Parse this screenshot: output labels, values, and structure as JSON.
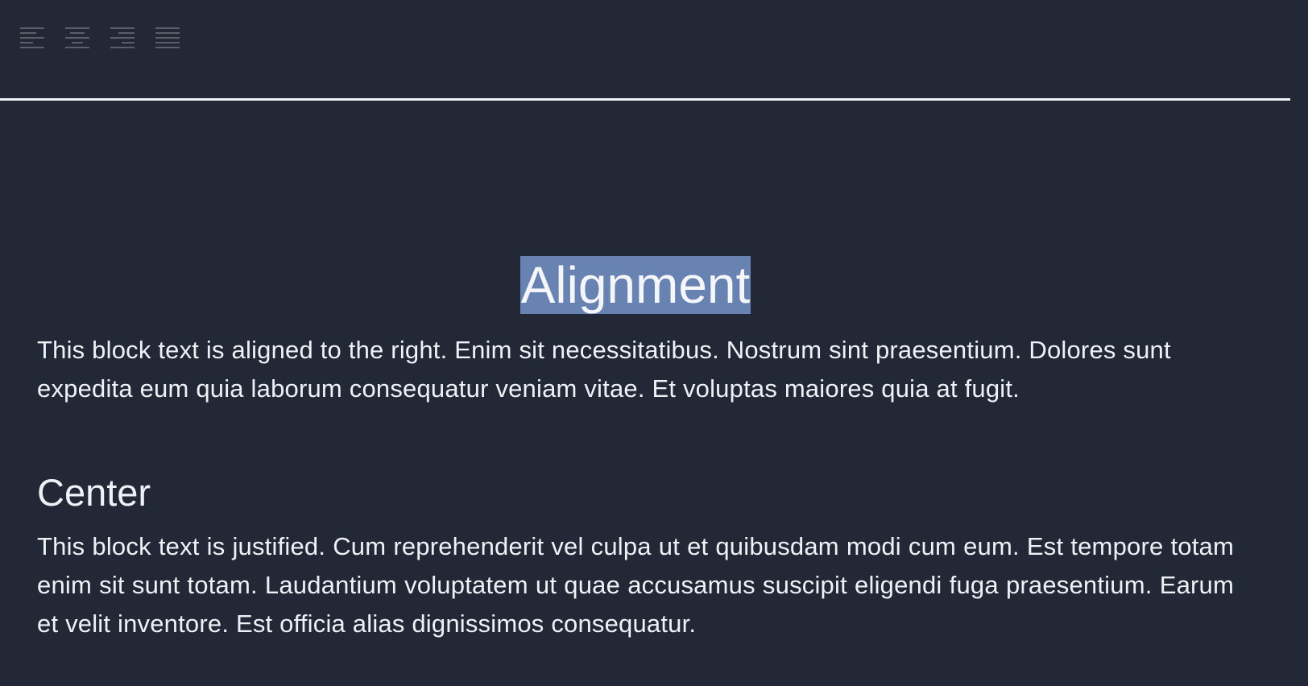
{
  "toolbar": {
    "buttons": [
      {
        "name": "align-left",
        "icon": "align-left-icon"
      },
      {
        "name": "align-center",
        "icon": "align-center-icon"
      },
      {
        "name": "align-right",
        "icon": "align-right-icon"
      },
      {
        "name": "align-justify",
        "icon": "align-justify-icon"
      }
    ],
    "icon_color": "#5a5f69"
  },
  "document": {
    "title": "Alignment",
    "paragraph_1": "This block text is aligned to the right. Enim sit necessitatibus. Nostrum sint praesentium. Dolores sunt expedita eum quia laborum consequatur veniam vitae. Et voluptas maiores quia at fugit.",
    "heading_2": "Center",
    "paragraph_2": "This block text is justified. Cum reprehenderit vel culpa ut et quibusdam modi cum eum. Est tempore totam enim sit sunt totam. Laudantium voluptatem ut quae accusamus suscipit eligendi fuga praesentium. Earum et velit inventore. Est officia alias dignissimos consequatur."
  },
  "colors": {
    "background": "#222836",
    "text": "#eef1f6",
    "selection": "#6882b2",
    "divider": "#eef1f6"
  }
}
